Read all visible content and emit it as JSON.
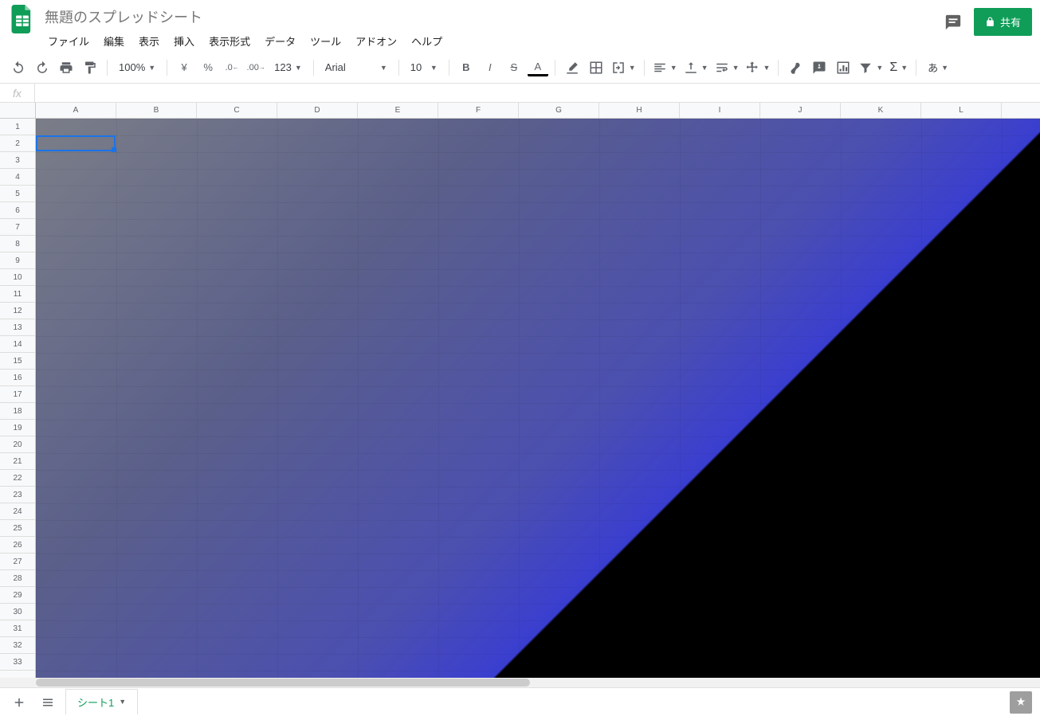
{
  "doc": {
    "title": "無題のスプレッドシート"
  },
  "menus": {
    "file": "ファイル",
    "edit": "編集",
    "view": "表示",
    "insert": "挿入",
    "format": "表示形式",
    "data": "データ",
    "tools": "ツール",
    "addons": "アドオン",
    "help": "ヘルプ"
  },
  "share": {
    "label": "共有"
  },
  "toolbar": {
    "zoom": "100%",
    "currency": "¥",
    "percent": "%",
    "dec_dec": ".0",
    "inc_dec": ".00",
    "moreformats": "123",
    "font": "Arial",
    "fontsize": "10",
    "input_tools": "あ"
  },
  "fx": {
    "label": "fx",
    "value": ""
  },
  "columns": [
    "A",
    "B",
    "C",
    "D",
    "E",
    "F",
    "G",
    "H",
    "I",
    "J",
    "K",
    "L"
  ],
  "rows_visible": 33,
  "selected_cell": "A2",
  "sheet": {
    "name": "シート1"
  }
}
